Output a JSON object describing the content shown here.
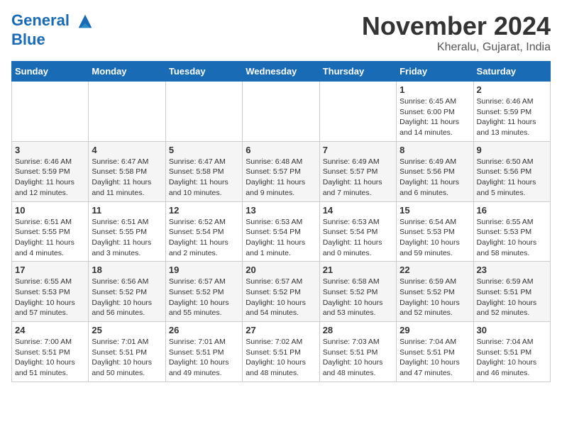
{
  "header": {
    "logo_line1": "General",
    "logo_line2": "Blue",
    "month_title": "November 2024",
    "location": "Kheralu, Gujarat, India"
  },
  "weekdays": [
    "Sunday",
    "Monday",
    "Tuesday",
    "Wednesday",
    "Thursday",
    "Friday",
    "Saturday"
  ],
  "weeks": [
    [
      {
        "day": "",
        "info": ""
      },
      {
        "day": "",
        "info": ""
      },
      {
        "day": "",
        "info": ""
      },
      {
        "day": "",
        "info": ""
      },
      {
        "day": "",
        "info": ""
      },
      {
        "day": "1",
        "info": "Sunrise: 6:45 AM\nSunset: 6:00 PM\nDaylight: 11 hours\nand 14 minutes."
      },
      {
        "day": "2",
        "info": "Sunrise: 6:46 AM\nSunset: 5:59 PM\nDaylight: 11 hours\nand 13 minutes."
      }
    ],
    [
      {
        "day": "3",
        "info": "Sunrise: 6:46 AM\nSunset: 5:59 PM\nDaylight: 11 hours\nand 12 minutes."
      },
      {
        "day": "4",
        "info": "Sunrise: 6:47 AM\nSunset: 5:58 PM\nDaylight: 11 hours\nand 11 minutes."
      },
      {
        "day": "5",
        "info": "Sunrise: 6:47 AM\nSunset: 5:58 PM\nDaylight: 11 hours\nand 10 minutes."
      },
      {
        "day": "6",
        "info": "Sunrise: 6:48 AM\nSunset: 5:57 PM\nDaylight: 11 hours\nand 9 minutes."
      },
      {
        "day": "7",
        "info": "Sunrise: 6:49 AM\nSunset: 5:57 PM\nDaylight: 11 hours\nand 7 minutes."
      },
      {
        "day": "8",
        "info": "Sunrise: 6:49 AM\nSunset: 5:56 PM\nDaylight: 11 hours\nand 6 minutes."
      },
      {
        "day": "9",
        "info": "Sunrise: 6:50 AM\nSunset: 5:56 PM\nDaylight: 11 hours\nand 5 minutes."
      }
    ],
    [
      {
        "day": "10",
        "info": "Sunrise: 6:51 AM\nSunset: 5:55 PM\nDaylight: 11 hours\nand 4 minutes."
      },
      {
        "day": "11",
        "info": "Sunrise: 6:51 AM\nSunset: 5:55 PM\nDaylight: 11 hours\nand 3 minutes."
      },
      {
        "day": "12",
        "info": "Sunrise: 6:52 AM\nSunset: 5:54 PM\nDaylight: 11 hours\nand 2 minutes."
      },
      {
        "day": "13",
        "info": "Sunrise: 6:53 AM\nSunset: 5:54 PM\nDaylight: 11 hours\nand 1 minute."
      },
      {
        "day": "14",
        "info": "Sunrise: 6:53 AM\nSunset: 5:54 PM\nDaylight: 11 hours\nand 0 minutes."
      },
      {
        "day": "15",
        "info": "Sunrise: 6:54 AM\nSunset: 5:53 PM\nDaylight: 10 hours\nand 59 minutes."
      },
      {
        "day": "16",
        "info": "Sunrise: 6:55 AM\nSunset: 5:53 PM\nDaylight: 10 hours\nand 58 minutes."
      }
    ],
    [
      {
        "day": "17",
        "info": "Sunrise: 6:55 AM\nSunset: 5:53 PM\nDaylight: 10 hours\nand 57 minutes."
      },
      {
        "day": "18",
        "info": "Sunrise: 6:56 AM\nSunset: 5:52 PM\nDaylight: 10 hours\nand 56 minutes."
      },
      {
        "day": "19",
        "info": "Sunrise: 6:57 AM\nSunset: 5:52 PM\nDaylight: 10 hours\nand 55 minutes."
      },
      {
        "day": "20",
        "info": "Sunrise: 6:57 AM\nSunset: 5:52 PM\nDaylight: 10 hours\nand 54 minutes."
      },
      {
        "day": "21",
        "info": "Sunrise: 6:58 AM\nSunset: 5:52 PM\nDaylight: 10 hours\nand 53 minutes."
      },
      {
        "day": "22",
        "info": "Sunrise: 6:59 AM\nSunset: 5:52 PM\nDaylight: 10 hours\nand 52 minutes."
      },
      {
        "day": "23",
        "info": "Sunrise: 6:59 AM\nSunset: 5:51 PM\nDaylight: 10 hours\nand 52 minutes."
      }
    ],
    [
      {
        "day": "24",
        "info": "Sunrise: 7:00 AM\nSunset: 5:51 PM\nDaylight: 10 hours\nand 51 minutes."
      },
      {
        "day": "25",
        "info": "Sunrise: 7:01 AM\nSunset: 5:51 PM\nDaylight: 10 hours\nand 50 minutes."
      },
      {
        "day": "26",
        "info": "Sunrise: 7:01 AM\nSunset: 5:51 PM\nDaylight: 10 hours\nand 49 minutes."
      },
      {
        "day": "27",
        "info": "Sunrise: 7:02 AM\nSunset: 5:51 PM\nDaylight: 10 hours\nand 48 minutes."
      },
      {
        "day": "28",
        "info": "Sunrise: 7:03 AM\nSunset: 5:51 PM\nDaylight: 10 hours\nand 48 minutes."
      },
      {
        "day": "29",
        "info": "Sunrise: 7:04 AM\nSunset: 5:51 PM\nDaylight: 10 hours\nand 47 minutes."
      },
      {
        "day": "30",
        "info": "Sunrise: 7:04 AM\nSunset: 5:51 PM\nDaylight: 10 hours\nand 46 minutes."
      }
    ]
  ]
}
